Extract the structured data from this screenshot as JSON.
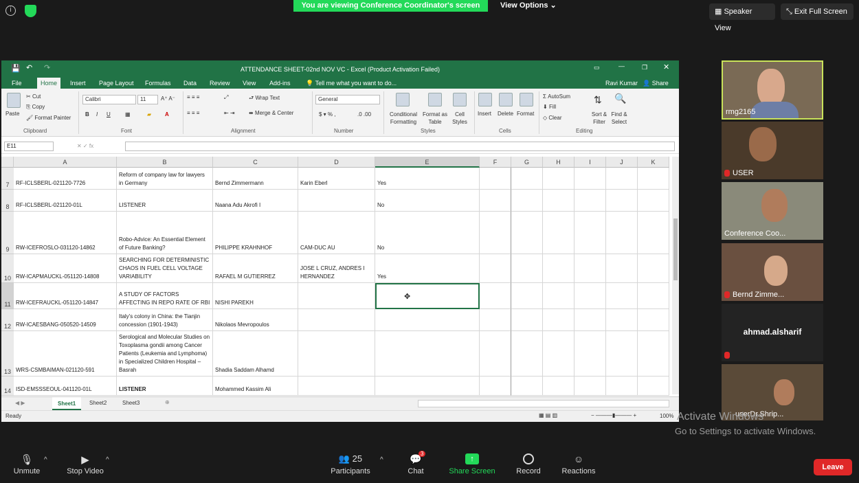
{
  "zoom": {
    "viewing_banner": "You are viewing Conference Coordinator's screen",
    "view_options": "View Options",
    "speaker_view": "Speaker View",
    "exit_full_screen": "Exit Full Screen"
  },
  "excel": {
    "window_title": "ATTENDANCE SHEET-02nd NOV VC - Excel (Product Activation Failed)",
    "user": "Ravi Kumar",
    "share": "Share",
    "tabs": [
      "File",
      "Home",
      "Insert",
      "Page Layout",
      "Formulas",
      "Data",
      "Review",
      "View",
      "Add-ins"
    ],
    "tell_me": "Tell me what you want to do...",
    "ribbon": {
      "paste": "Paste",
      "cut": "Cut",
      "copy": "Copy",
      "format_painter": "Format Painter",
      "clipboard": "Clipboard",
      "font_name": "Calibri",
      "font_size": "11",
      "font": "Font",
      "wrap_text": "Wrap Text",
      "merge_center": "Merge & Center",
      "alignment": "Alignment",
      "number_format": "General",
      "number": "Number",
      "conditional_formatting": "Conditional Formatting",
      "format_as_table": "Format as Table",
      "cell_styles": "Cell Styles",
      "styles": "Styles",
      "insert": "Insert",
      "delete": "Delete",
      "format": "Format",
      "cells": "Cells",
      "autosum": "AutoSum",
      "fill": "Fill",
      "clear": "Clear",
      "sort_filter": "Sort & Filter",
      "find_select": "Find & Select",
      "editing": "Editing"
    },
    "name_box": "E11",
    "columns": [
      "A",
      "B",
      "C",
      "D",
      "E",
      "F",
      "G",
      "H",
      "I",
      "J",
      "K"
    ],
    "rows": [
      {
        "num": "7",
        "a": "RF-ICLSBERL-021120-7726",
        "b": "Reform of company law for lawyers in Germany",
        "c": "Bernd Zimmermann",
        "d": "Karin Eberl",
        "e": "Yes"
      },
      {
        "num": "8",
        "a": "RF-ICLSBERL-021120-01L",
        "b": "LISTENER",
        "c": "Naana Adu Akrofi I",
        "d": "",
        "e": "No"
      },
      {
        "num": "9",
        "a": "RW-ICEFROSLO-031120-14862",
        "b": "Robo-Advice: An Essential Element of Future Banking?",
        "c": "PHILIPPE KRAHNHOF",
        "d": "CAM-DUC AU",
        "e": "No"
      },
      {
        "num": "10",
        "a": "RW-ICAPMAUCKL-051120-14808",
        "b": "SEARCHING FOR DETERMINISTIC CHAOS IN FUEL CELL VOLTAGE VARIABILITY",
        "c": "RAFAEL M GUTIERREZ",
        "d": "JOSE L CRUZ, ANDRES I HERNANDEZ",
        "e": "Yes"
      },
      {
        "num": "11",
        "a": "RW-ICEFRAUCKL-051120-14847",
        "b": "A STUDY OF FACTORS AFFECTING IN REPO RATE OF RBI",
        "c": "NISHI PAREKH",
        "d": "",
        "e": ""
      },
      {
        "num": "12",
        "a": "RW-ICAESBANG-050520-14509",
        "b": "Italy's colony in China: the Tianjin concession (1901-1943)",
        "c": "Nikolaos Mevropoulos",
        "d": "",
        "e": ""
      },
      {
        "num": "13",
        "a": "WRS-CSMBAIMAN-021120-591",
        "b": "Serological and Molecular Studies on Toxoplasma gondii among Cancer Patients (Leukemia and Lymphoma) in Specialized Children Hospital – Basrah",
        "c": "Shadia Saddam Alhamd",
        "d": "",
        "e": ""
      },
      {
        "num": "14",
        "a": "ISD-EMSSSEOUL-041120-01L",
        "b": "LISTENER",
        "c": "Mohammed Kassim Ali",
        "d": "",
        "e": ""
      }
    ],
    "sheets": [
      "Sheet1",
      "Sheet2",
      "Sheet3"
    ],
    "status": "Ready",
    "zoom_level": "100%"
  },
  "participants_tiles": [
    {
      "name": "rmg2165",
      "muted": false
    },
    {
      "name": "USER",
      "muted": true
    },
    {
      "name": "Conference Coo...",
      "muted": false
    },
    {
      "name": "Bernd Zimme...",
      "muted": true
    },
    {
      "name": "ahmad.alsharif",
      "muted": true
    },
    {
      "name": "userDr.Shrip...",
      "muted": false
    }
  ],
  "bottom_bar": {
    "unmute": "Unmute",
    "stop_video": "Stop Video",
    "participants": "Participants",
    "participant_count": "25",
    "chat": "Chat",
    "chat_badge": "3",
    "share_screen": "Share Screen",
    "record": "Record",
    "reactions": "Reactions",
    "leave": "Leave"
  },
  "watermark": {
    "line1": "Activate Windows",
    "line2": "Go to Settings to activate Windows."
  },
  "colors": {
    "excel_green": "#217346",
    "zoom_green": "#23d959",
    "leave_red": "#e02828"
  }
}
